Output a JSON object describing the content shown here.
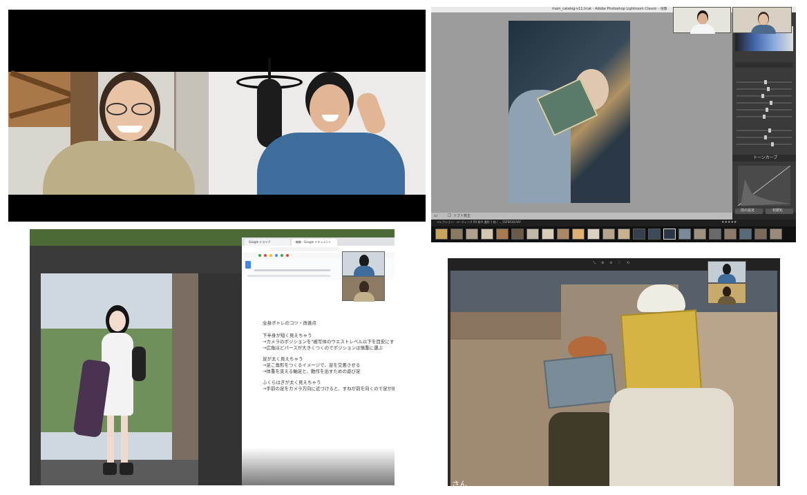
{
  "lightroom": {
    "window_title": "main_catalog-v11.lrcat - Adobe Photoshop Lightroom Classic - 現像",
    "panel_tone_curve": "トーンカーブ",
    "toolbar_label": "ソフト校正",
    "button_prev": "前の設定",
    "button_reset": "初期化",
    "filmstrip_info": "コレクション：コーディング  60 枚中 選択 1 枚 / ..._SSF6618.RAF"
  },
  "share": {
    "tabs": [
      "Google ドライブ",
      "編集 - Google ドキュメント"
    ],
    "doc_lines": [
      "全身ポトレのコツ・改善点",
      "下半身が短く見えちゃう",
      "→カメラのポジションを\"被写体のウエストレベル以下を目安にする",
      "→広角ほどパースが大きくつくのでポジションは慎重に選ぶ",
      "足が太く見えちゃう",
      "→足こ角形をつくるイメージで、足を交差させる",
      "→体重を支える軸足と、動作を出すための遊び足",
      "ふくらはぎが太く見えちゃう",
      "→手前の足をカメラ方向に近づけると、すねが前を向くので足が細く見"
    ]
  },
  "bookshop": {
    "caption": "さん"
  },
  "colors": {
    "lr_bg": "#9c9c9c",
    "lr_panel": "#3a3a3a",
    "doc_blue": "#4285f4"
  }
}
